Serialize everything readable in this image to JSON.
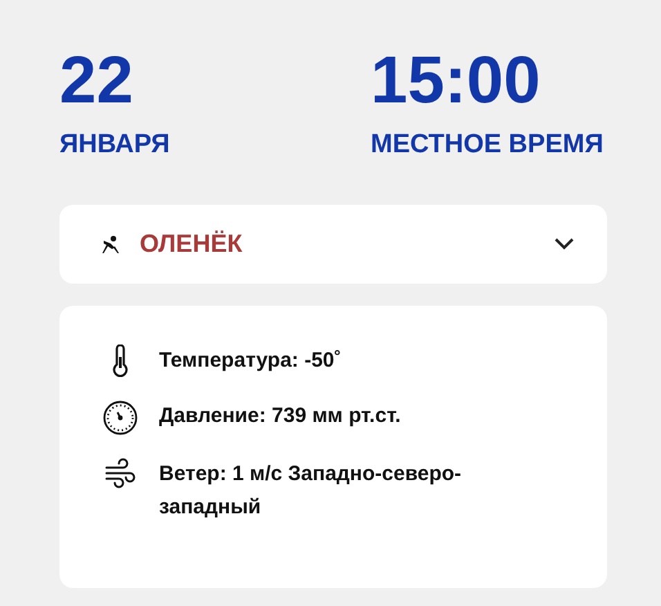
{
  "date": {
    "day": "22",
    "month": "ЯНВАРЯ"
  },
  "time": {
    "value": "15:00",
    "label": "МЕСТНОЕ ВРЕМЯ"
  },
  "location": {
    "name": "ОЛЕНЁК",
    "expanded": false
  },
  "weather": [
    {
      "kind": "temperature",
      "text": "Температура: -50˚"
    },
    {
      "kind": "pressure",
      "text": "Давление: 739 мм рт.ст."
    },
    {
      "kind": "wind",
      "text": "Ветер: 1 м/с Западно-северо-западный"
    }
  ]
}
